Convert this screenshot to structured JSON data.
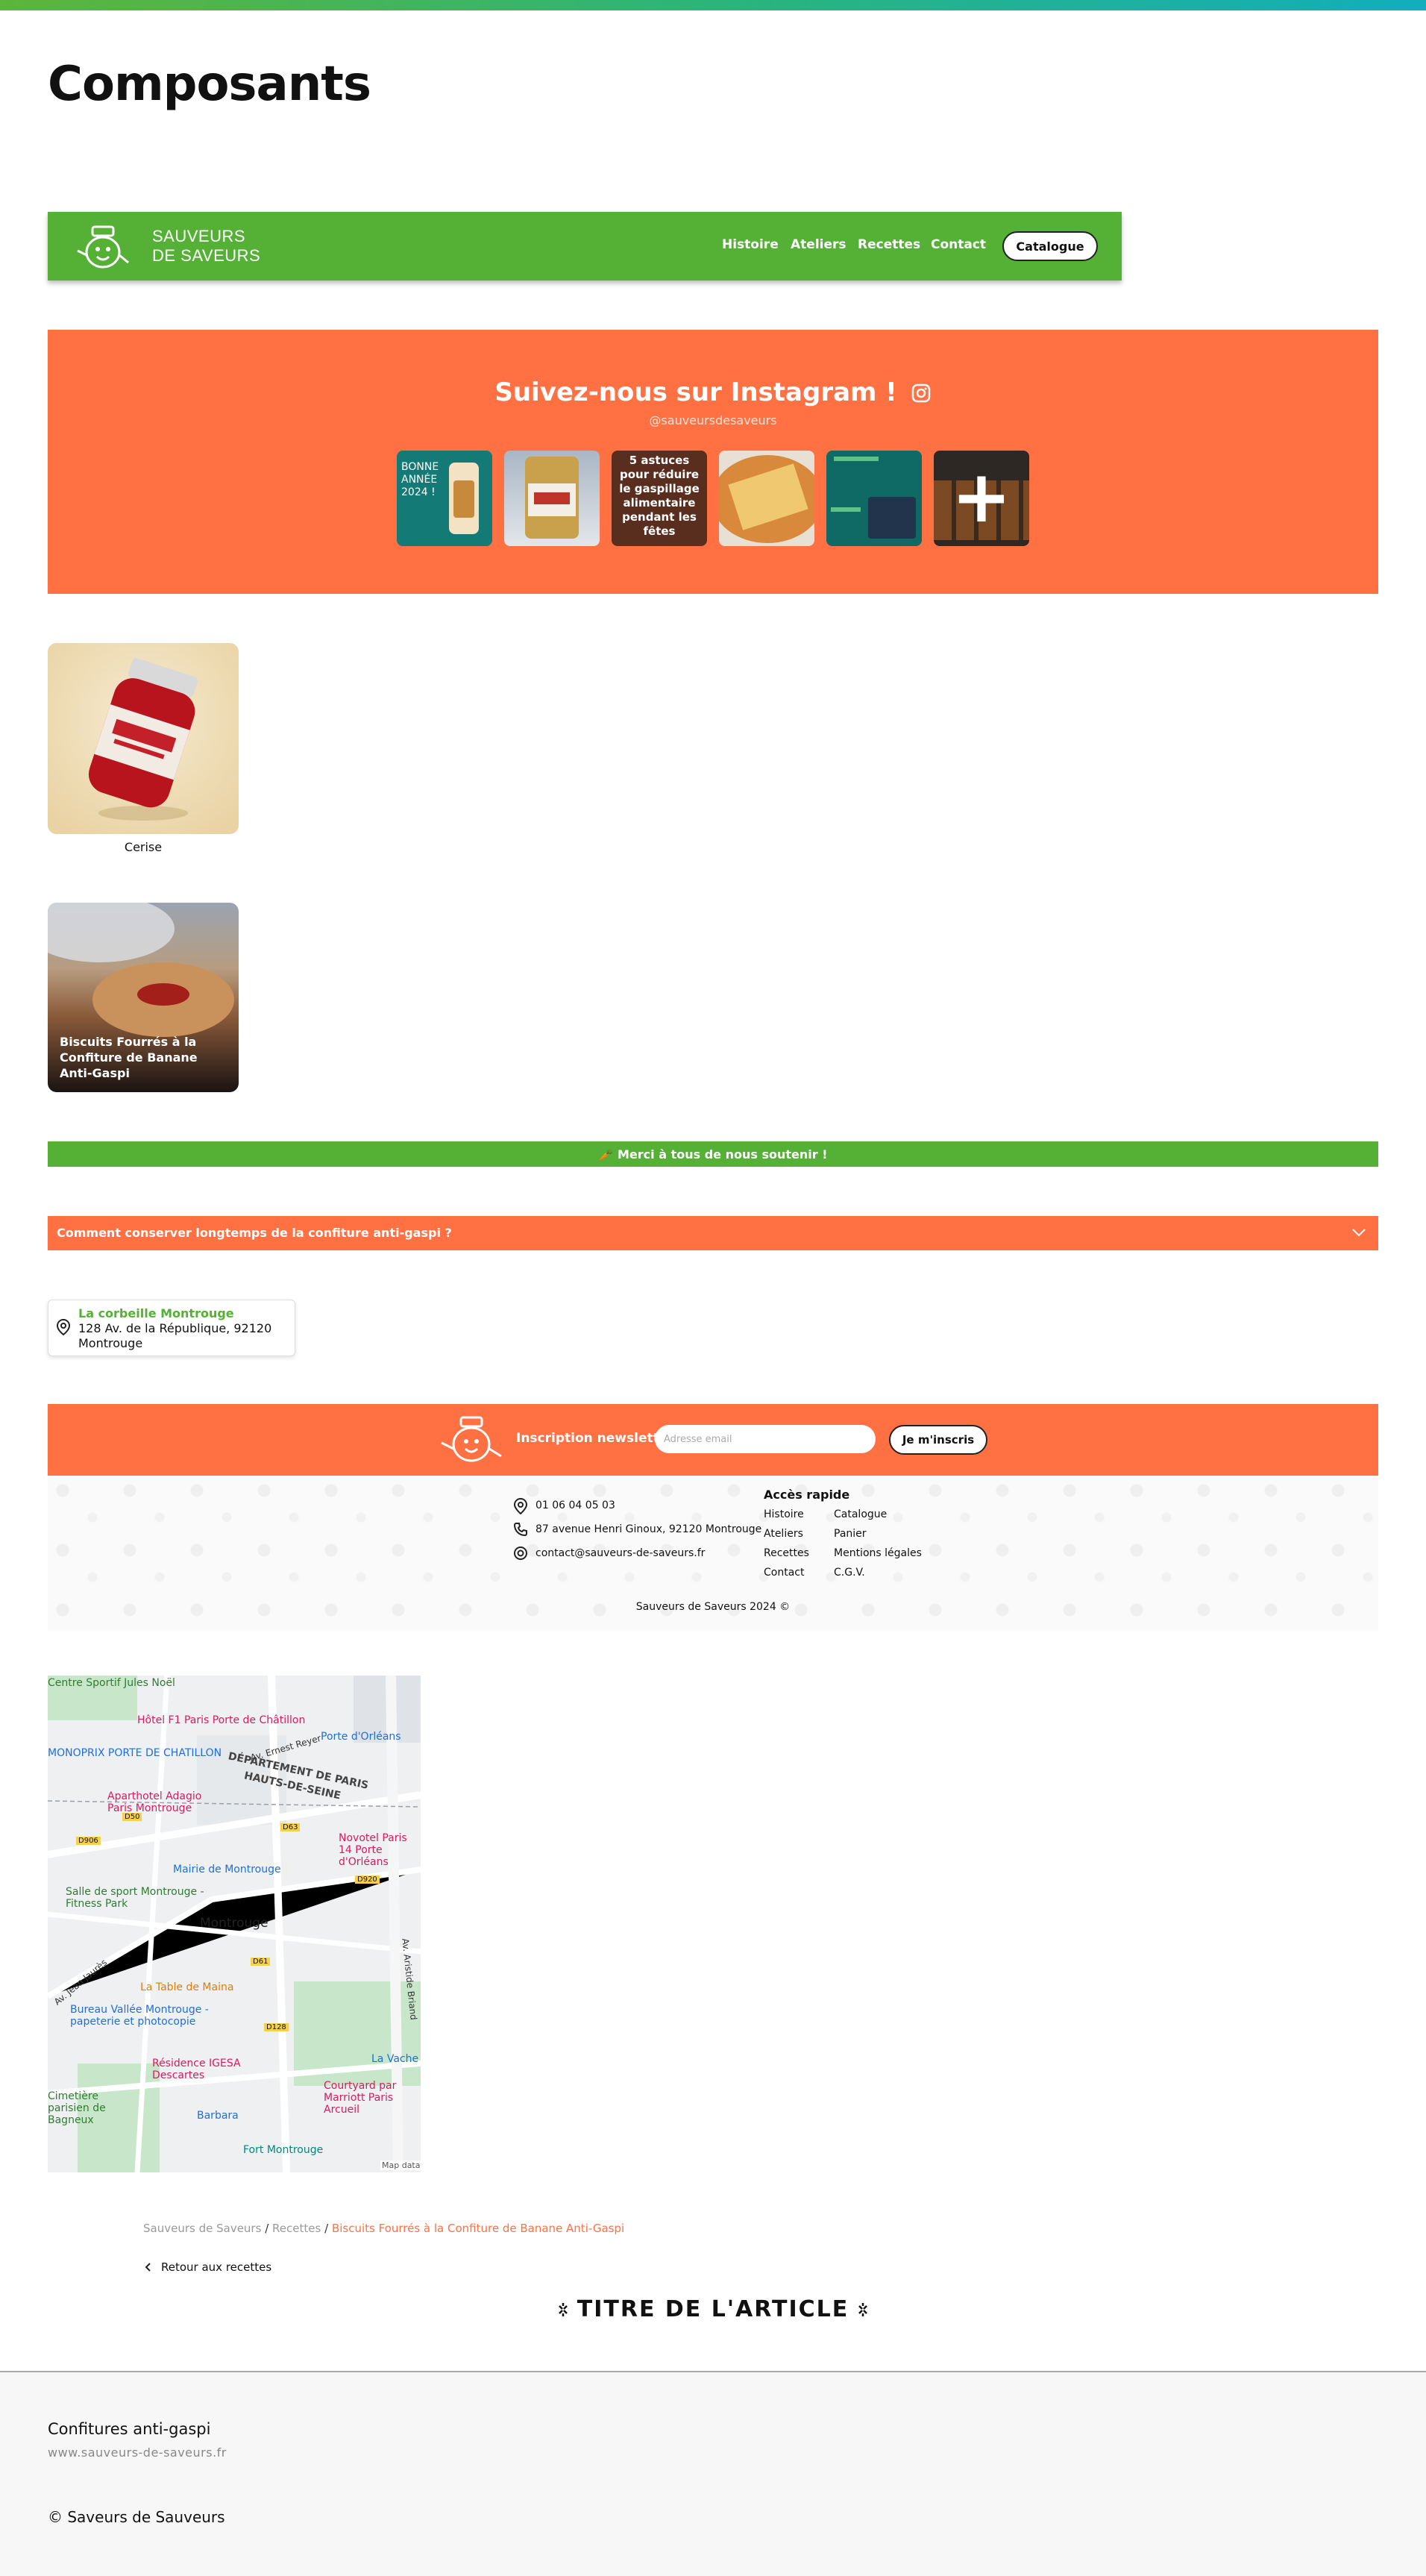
{
  "page": {
    "title": "Composants"
  },
  "header": {
    "brand_line1": "SAUVEURS",
    "brand_line2": "DE SAVEURS",
    "nav": [
      "Histoire",
      "Ateliers",
      "Recettes",
      "Contact"
    ],
    "catalogue_label": "Catalogue",
    "bg_color": "#55b135"
  },
  "instagram": {
    "title": "Suivez-nous sur Instagram !",
    "handle": "@sauveursdesaveurs",
    "posts": [
      {
        "text": "BONNE ANNÉE 2024 !"
      },
      {
        "text": ""
      },
      {
        "text": "5 astuces pour réduire le gaspillage alimentaire pendant les fêtes"
      },
      {
        "text": ""
      },
      {
        "text": ""
      },
      {
        "text": "+"
      }
    ],
    "bg_color": "#ff7043"
  },
  "product": {
    "name": "Cerise"
  },
  "recipe": {
    "title": "Biscuits Fourrés à la Confiture de Banane Anti-Gaspi"
  },
  "thanks_banner": {
    "text": "🥕 Merci à tous de nous soutenir !"
  },
  "faq": {
    "question": "Comment conserver longtemps de la confiture anti-gaspi ?"
  },
  "store": {
    "name": "La corbeille Montrouge",
    "address": "128 Av. de la République, 92120 Montrouge"
  },
  "newsletter": {
    "label": "Inscription newsletter",
    "placeholder": "Adresse email",
    "button": "Je m'inscris"
  },
  "footer_contact": {
    "phone": "01 06 04 05 03",
    "address": "87 avenue Henri Ginoux, 92120 Montrouge",
    "email": "contact@sauveurs-de-saveurs.fr",
    "quick_title": "Accès rapide",
    "col1": [
      "Histoire",
      "Ateliers",
      "Recettes",
      "Contact"
    ],
    "col2": [
      "Catalogue",
      "Panier",
      "Mentions légales",
      "C.G.V."
    ],
    "copyright": "Sauveurs de Saveurs 2024 ©"
  },
  "map": {
    "places": [
      "Centre Sportif Jules Noël",
      "Hôtel F1 Paris Porte de Châtillon",
      "MONOPRIX PORTE DE CHATILLON",
      "Porte d'Orléans",
      "DÉPARTEMENT DE PARIS",
      "HAUTS-DE-SEINE",
      "Aparthotel Adagio Paris Montrouge",
      "Novotel Paris 14 Porte d'Orléans",
      "Mairie de Montrouge",
      "Salle de sport Montrouge - Fitness Park",
      "Montrouge",
      "La Table de Maina",
      "Bureau Vallée Montrouge - papeterie et photocopie",
      "Résidence IGESA Descartes",
      "Courtyard par Marriott Paris Arcueil",
      "Barbara",
      "Fort Montrouge",
      "Cimetière parisien de Bagneux",
      "La Vache",
      "Map data"
    ],
    "roads": [
      "Av. Ernest Reyer",
      "Av. Jean Jaurès",
      "Av. Aristide Briand",
      "D906",
      "D63",
      "D61",
      "D128",
      "D920",
      "D50"
    ]
  },
  "breadcrumb": {
    "items": [
      "Sauveurs de Saveurs",
      "Recettes"
    ],
    "current": "Biscuits Fourrés à la Confiture de Banane Anti-Gaspi",
    "separator": "/"
  },
  "back_link": "Retour aux recettes",
  "article_title": "TITRE DE L'ARTICLE",
  "site_footer": {
    "name": "Confitures anti-gaspi",
    "url": "www.sauveurs-de-saveurs.fr",
    "copyright": "© Saveurs de Sauveurs"
  }
}
